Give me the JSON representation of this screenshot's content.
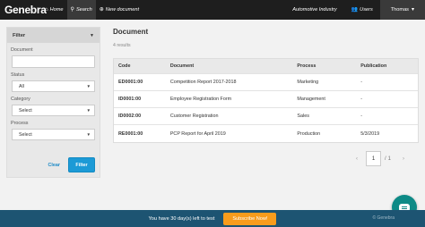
{
  "topbar": {
    "logo": "Genebra",
    "nav": [
      {
        "label": "Home",
        "icon": "home-icon"
      },
      {
        "label": "Search",
        "icon": "search-icon"
      },
      {
        "label": "New document",
        "icon": "plus-circle-icon"
      }
    ],
    "industry": "Automotive Industry",
    "users_label": "Users",
    "user_name": "Thomas"
  },
  "sidebar": {
    "filter_title": "Filter",
    "document_label": "Document",
    "document_value": "",
    "status_label": "Status",
    "status_value": "All",
    "category_label": "Category",
    "category_value": "Select",
    "process_label": "Process",
    "process_value": "Select",
    "clear_label": "Clear",
    "filter_button": "Filter"
  },
  "main": {
    "title": "Document",
    "results": "4 results",
    "columns": [
      "Code",
      "Document",
      "Process",
      "Publication"
    ],
    "rows": [
      {
        "code": "ED0001:00",
        "document": "Competition Report 2017-2018",
        "process": "Marketing",
        "publication": "-"
      },
      {
        "code": "ID0001:00",
        "document": "Employee Registration Form",
        "process": "Management",
        "publication": "-"
      },
      {
        "code": "ID0002:00",
        "document": "Customer Registration",
        "process": "Sales",
        "publication": "-"
      },
      {
        "code": "RE0001:00",
        "document": "PCP Report for April 2019",
        "process": "Production",
        "publication": "5/3/2019"
      }
    ],
    "pager": {
      "current": "1",
      "total": "1"
    }
  },
  "bottombar": {
    "trial_text": "You have 30 day(s) left to test",
    "subscribe": "Subscribe Now!",
    "copyright": "© Genebra"
  }
}
